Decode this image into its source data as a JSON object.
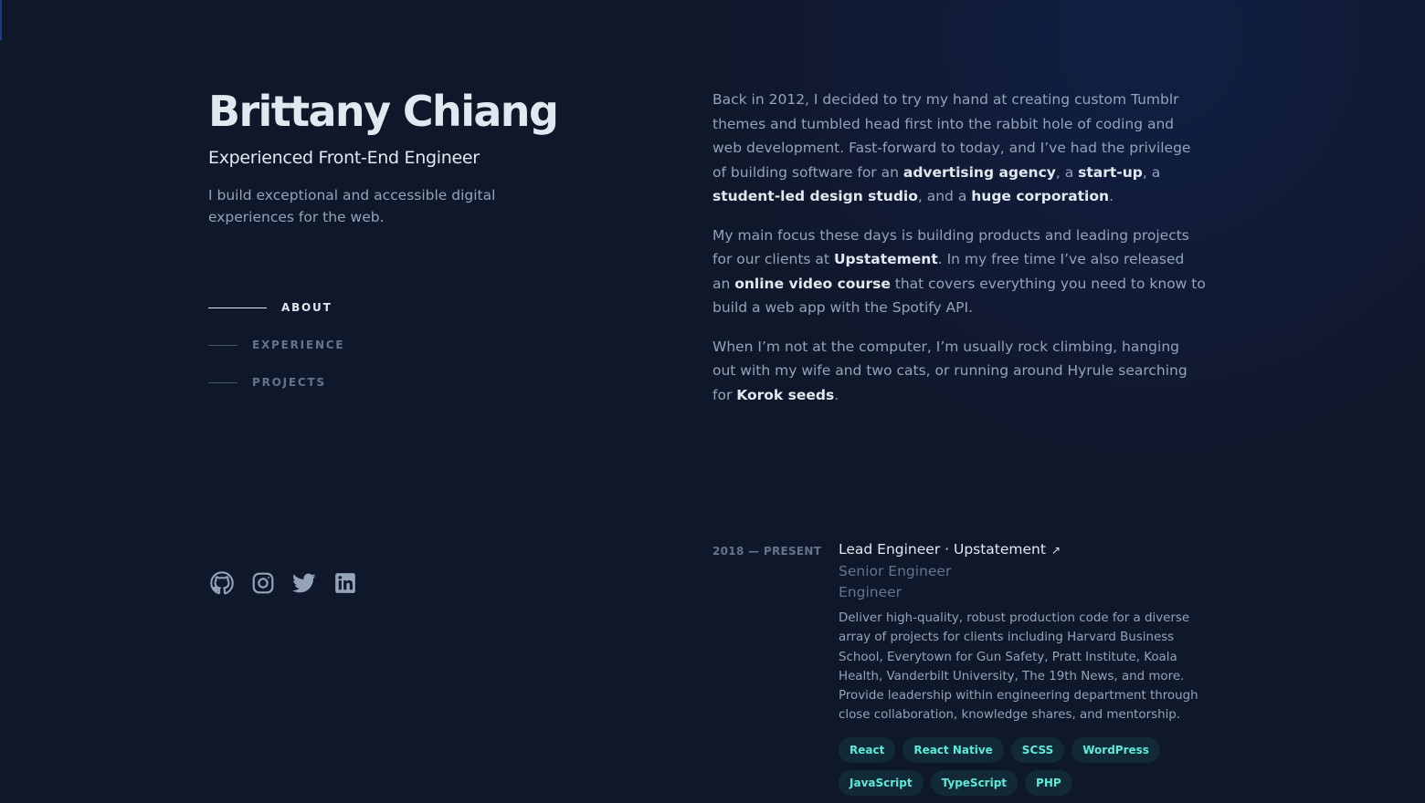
{
  "header": {
    "name": "Brittany Chiang",
    "role": "Experienced Front-End Engineer",
    "tagline": "I build exceptional and accessible digital experiences for the web."
  },
  "nav": {
    "items": [
      {
        "label": "ABOUT",
        "active": true
      },
      {
        "label": "EXPERIENCE",
        "active": false
      },
      {
        "label": "PROJECTS",
        "active": false
      }
    ]
  },
  "socials": [
    {
      "name": "github-icon"
    },
    {
      "name": "instagram-icon"
    },
    {
      "name": "twitter-icon"
    },
    {
      "name": "linkedin-icon"
    }
  ],
  "about": {
    "p1": {
      "t1": "Back in 2012, I decided to try my hand at creating custom Tumblr themes and tumbled head first into the rabbit hole of coding and web development. Fast-forward to today, and I’ve had the privilege of building software for an ",
      "h1": "advertising agency",
      "t2": ", a ",
      "h2": "start-up",
      "t3": ", a ",
      "h3": "student-led design studio",
      "t4": ", and a ",
      "h4": "huge corporation",
      "t5": "."
    },
    "p2": {
      "t1": "My main focus these days is building products and leading projects for our clients at ",
      "h1": "Upstatement",
      "t2": ". In my free time I’ve also released an ",
      "h2": "online video course",
      "t3": " that covers everything you need to know to build a web app with the Spotify API."
    },
    "p3": {
      "t1": "When I’m not at the computer, I’m usually rock climbing, hanging out with my wife and two cats, or running around Hyrule searching for ",
      "h1": "Korok seeds",
      "t2": "."
    }
  },
  "experience": {
    "date": "2018 — PRESENT",
    "title": "Lead Engineer · Upstatement",
    "arrow": "↗",
    "previous_titles": [
      "Senior Engineer",
      "Engineer"
    ],
    "description": "Deliver high-quality, robust production code for a diverse array of projects for clients including Harvard Business School, Everytown for Gun Safety, Pratt Institute, Koala Health, Vanderbilt University, The 19th News, and more. Provide leadership within engineering department through close collaboration, knowledge shares, and mentorship.",
    "tags": [
      "React",
      "React Native",
      "SCSS",
      "WordPress",
      "JavaScript",
      "TypeScript",
      "PHP"
    ]
  },
  "colors": {
    "background": "#0f172a",
    "heading": "#e2e8f0",
    "text": "#94a3b8",
    "muted": "#64748b",
    "accent": "#5eead4"
  }
}
